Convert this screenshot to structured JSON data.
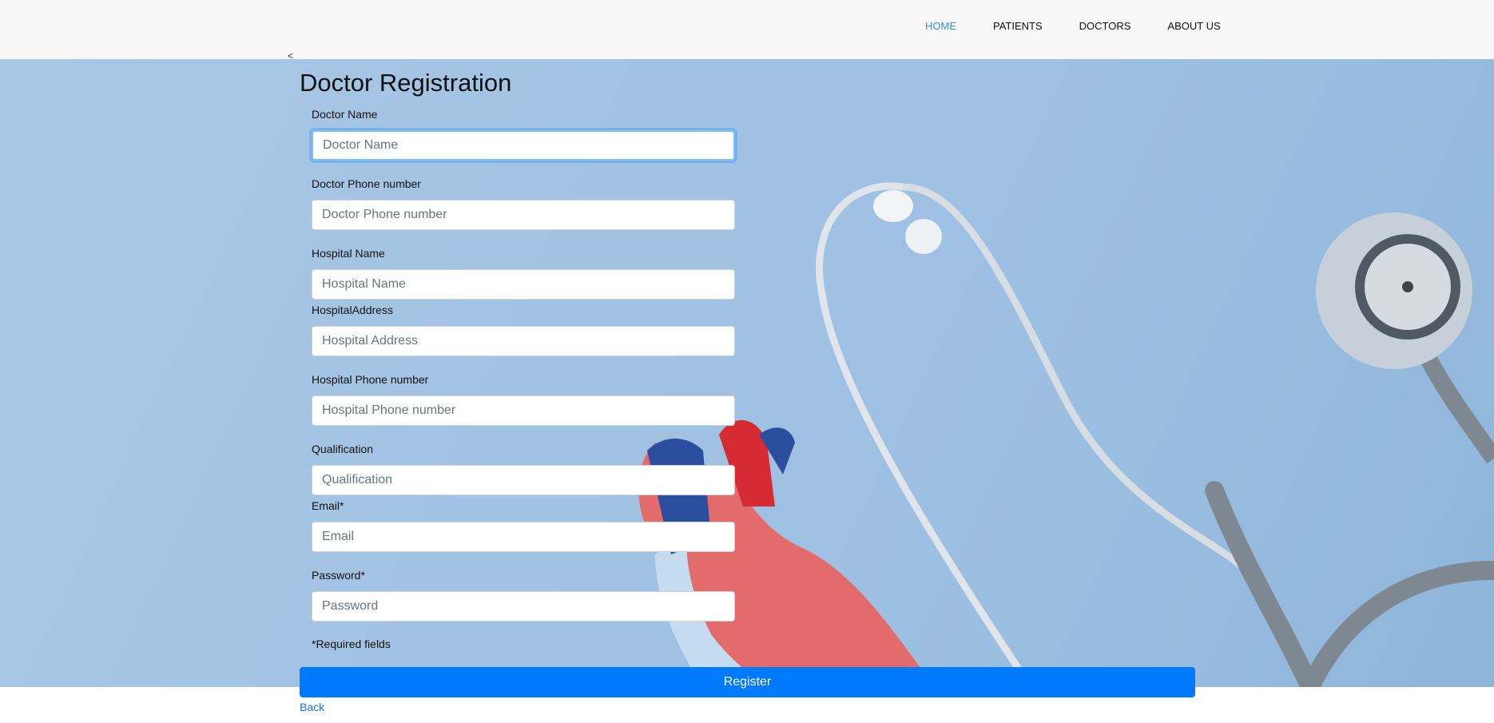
{
  "nav": {
    "items": [
      {
        "label": "HOME",
        "active": true
      },
      {
        "label": "PATIENTS",
        "active": false
      },
      {
        "label": "DOCTORS",
        "active": false
      },
      {
        "label": "ABOUT US",
        "active": false
      }
    ]
  },
  "form": {
    "back_chevron": "<",
    "title": "Doctor Registration",
    "fields": {
      "doctor_name": {
        "label": "Doctor Name",
        "placeholder": "Doctor Name"
      },
      "doctor_phone": {
        "label": "Doctor Phone number",
        "placeholder": "Doctor Phone number"
      },
      "hospital_name": {
        "label": "Hospital Name",
        "placeholder": "Hospital Name"
      },
      "hospital_address": {
        "label": "HospitalAddress",
        "placeholder": "Hospital Address"
      },
      "hospital_phone": {
        "label": "Hospital Phone number",
        "placeholder": "Hospital Phone number"
      },
      "qualification": {
        "label": "Qualification",
        "placeholder": "Qualification"
      },
      "email": {
        "label": "Email*",
        "placeholder": "Email"
      },
      "password": {
        "label": "Password*",
        "placeholder": "Password"
      }
    },
    "required_note": "*Required fields",
    "register_label": "Register",
    "back_label": "Back"
  },
  "colors": {
    "accent": "#007bff",
    "nav_active": "#3d8fd1",
    "hero_bg": "#a2c2e3"
  },
  "background_image": "stethoscope-and-heart-model"
}
